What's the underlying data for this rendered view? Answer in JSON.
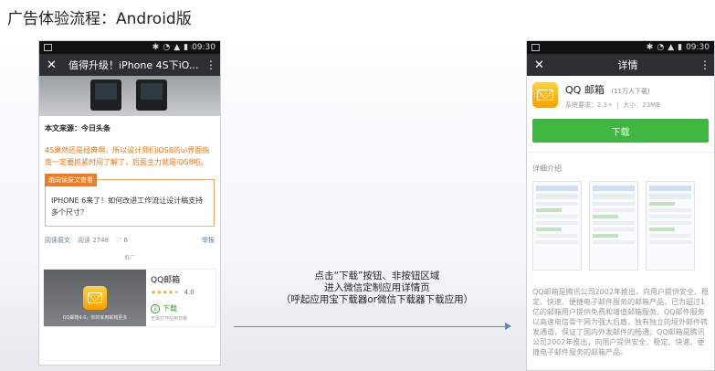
{
  "slide": {
    "title": "广告体验流程：Android版"
  },
  "status": {
    "time": "09:30"
  },
  "left_phone": {
    "appbar_title": "值得升级！iPhone 4S下iO...",
    "source": "本文来源：今日头条",
    "article_text": "4S果然还是经典啊，所以设计师们iOS8的ui界面指南一定要抓紧时间了解了，后面主力就是iOS8啦。",
    "related_tag": "跑向读原文查看",
    "related_text": "IPHONE 6来了！如何改进工作流让设计稿支持多个尺寸？",
    "read_original": "阅读原文",
    "read_count": "阅读 2748",
    "like_count": "6",
    "report": "举报",
    "promo_label": "推广",
    "ad": {
      "name": "QQ邮箱",
      "rating": "4.0",
      "download": "下载",
      "image_caption": "QQ邮箱4.0，你的家用邮箱更多",
      "sub": "无需打开应用安装"
    }
  },
  "caption": {
    "line1": "点击“下载”按钮、非按钮区域",
    "line2": "进入微信定制应用详情页",
    "line3": "（呼起应用宝下载器or微信下载器下载应用）"
  },
  "right_phone": {
    "appbar_title": "详情",
    "app_name": "QQ 邮箱",
    "downloads": "(11万人下载)",
    "system": "系统要求：2.3+",
    "size": "大小：23MB",
    "download_btn": "下载",
    "section_title": "详细介绍",
    "description": "QQ邮箱是腾讯公司2002年推出，向用户提供安全、稳定、快速、便捷电子邮件服务的邮箱产品，已为超过1亿的邮箱用户提供免费和增值邮箱服务。QQ邮件服务以高速电信骨干网为强大后盾，独有独立的境外邮件转发通道，保证了国内外发邮件的畅通；QQ邮箱是腾讯公司2002年推出，向用户提供安全、稳定、快速、便捷电子邮件服务的邮箱产品。"
  }
}
